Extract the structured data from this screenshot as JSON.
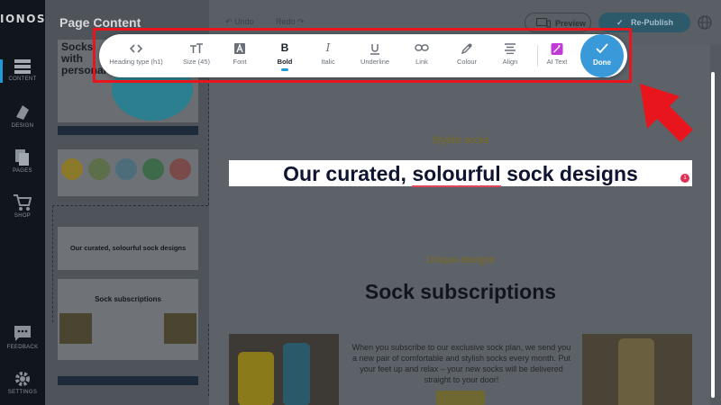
{
  "app": {
    "logo": "IONOS",
    "page_title": "Page Content"
  },
  "rail": {
    "items": [
      {
        "label": "CONTENT",
        "icon": "content-icon"
      },
      {
        "label": "DESIGN",
        "icon": "design-icon"
      },
      {
        "label": "PAGES",
        "icon": "pages-icon"
      },
      {
        "label": "SHOP",
        "icon": "cart-icon"
      },
      {
        "label": "FEEDBACK",
        "icon": "chat-icon"
      },
      {
        "label": "SETTINGS",
        "icon": "gear-icon"
      }
    ],
    "active": "CONTENT"
  },
  "topbar": {
    "undo": "Undo",
    "redo": "Redo",
    "preview": "Preview",
    "republish": "Re-Publish"
  },
  "thumbnails": {
    "hero_text": "Socks with personal",
    "curated_heading": "Our curated, solourful sock designs",
    "subscriptions_heading": "Sock subscriptions"
  },
  "toolbar": {
    "tools": [
      {
        "label": "Heading type (h1)",
        "icon": "code-brackets-icon"
      },
      {
        "label": "Size (45)",
        "icon": "text-size-icon"
      },
      {
        "label": "Font",
        "icon": "font-icon"
      },
      {
        "label": "Bold",
        "icon": "bold-icon"
      },
      {
        "label": "Italic",
        "icon": "italic-icon"
      },
      {
        "label": "Underline",
        "icon": "underline-icon"
      },
      {
        "label": "Link",
        "icon": "link-icon"
      },
      {
        "label": "Colour",
        "icon": "eyedropper-icon"
      },
      {
        "label": "Align",
        "icon": "align-icon"
      },
      {
        "label": "AI Text",
        "icon": "ai-magic-icon"
      }
    ],
    "active_tool": "Bold",
    "done": "Done"
  },
  "canvas": {
    "section1_tag": "Stylish socks",
    "heading_part1": "Our curated, ",
    "heading_misspelled": "solourful",
    "heading_part2": " sock designs",
    "spell_badge": "1",
    "section2_tag": "Unique designs",
    "section2_heading": "Sock subscriptions",
    "body": "When you subscribe to our exclusive sock plan, we send you a new pair of comfortable and stylish socks every month. Put your feet up and relax – your new socks will be delivered straight to your door!"
  },
  "colors": {
    "accent": "#1e9bd7",
    "done_button": "#3a9ad9",
    "highlight": "#e8151d",
    "ai_icon": "#c13ad8"
  }
}
